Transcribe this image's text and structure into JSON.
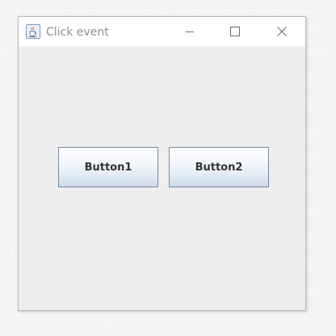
{
  "window": {
    "title": "Click event",
    "icon": "java-cup-icon",
    "controls": {
      "minimize": "minimize-icon",
      "maximize": "maximize-icon",
      "close": "close-icon"
    }
  },
  "buttons": [
    {
      "label": "Button1"
    },
    {
      "label": "Button2"
    }
  ],
  "colors": {
    "window_background": "#eeeeee",
    "titlebar_background": "#ffffff",
    "title_text": "#8f8f8f",
    "button_border": "#7a8aa0",
    "button_gradient_top": "#ffffff",
    "button_gradient_bottom": "#c9d8ea",
    "button_text": "#333333"
  }
}
